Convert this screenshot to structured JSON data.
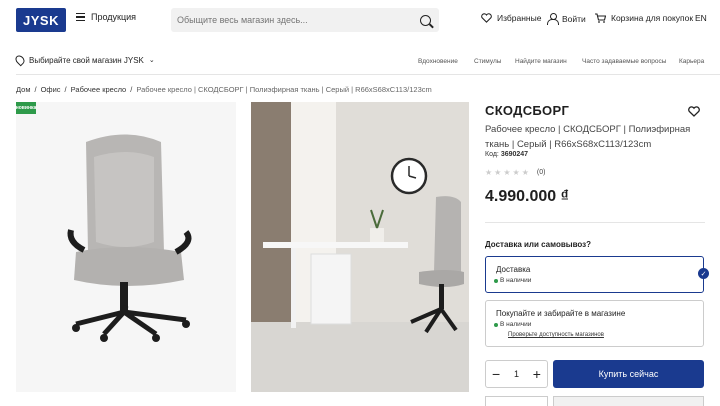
{
  "header": {
    "logo_text": "JYSK",
    "menu_label": "Продукция",
    "search_placeholder": "Обыщите весь магазин здесь...",
    "favorites": "Избранные",
    "login": "Войти",
    "cart": "Корзина для покупок",
    "lang": "EN"
  },
  "subbar": {
    "store_select": "Выбирайте свой магазин JYSK",
    "links": [
      "Вдохновение",
      "Стимулы",
      "Найдите магазин",
      "Часто задаваемые вопросы",
      "Карьера"
    ]
  },
  "breadcrumb": [
    "Дом",
    "Офис",
    "Рабочее кресло",
    "Рабочее кресло | СКОДСБОРГ | Полиэфирная ткань | Серый | R66xS68xC113/123cm"
  ],
  "badge": "новинка",
  "product": {
    "title": "СКОДСБОРГ",
    "description": "Рабочее кресло | СКОДСБОРГ | Полиэфирная ткань | Серый | R66xS68xC113/123cm",
    "code_label": "Код:",
    "code_value": "3690247",
    "reviews": "(0)",
    "rating": 0,
    "price": "4.990.000 ₫"
  },
  "delivery": {
    "question": "Доставка или самовывоз?",
    "option1_title": "Доставка",
    "option1_stock": "В наличии",
    "option2_title": "Покупайте и забирайте в магазине",
    "option2_stock": "В наличии",
    "option2_link": "Проверьте доступность магазинов"
  },
  "purchase": {
    "qty": "1",
    "buy_label": "Купить сейчас"
  },
  "colors": {
    "brand": "#1a3a8f",
    "stock": "#2e9a4a"
  }
}
